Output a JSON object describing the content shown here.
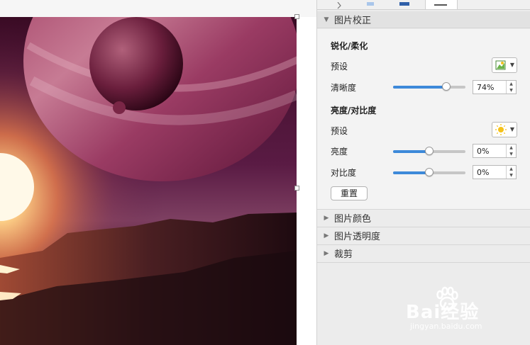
{
  "panel": {
    "section_open": {
      "title": "图片校正",
      "sharpen": {
        "heading": "锐化/柔化",
        "preset_label": "预设",
        "clarity_label": "清晰度",
        "clarity_value": "74%",
        "clarity_fraction": 0.74
      },
      "brightness_contrast": {
        "heading": "亮度/对比度",
        "preset_label": "预设",
        "brightness_label": "亮度",
        "brightness_value": "0%",
        "brightness_fraction": 0.5,
        "contrast_label": "对比度",
        "contrast_value": "0%",
        "contrast_fraction": 0.5
      },
      "reset_label": "重置"
    },
    "sections_closed": [
      {
        "title": "图片颜色"
      },
      {
        "title": "图片透明度"
      },
      {
        "title": "裁剪"
      }
    ]
  },
  "watermark": {
    "brand": "Bai经验",
    "url": "jingyan.baidu.com"
  },
  "colors": {
    "accent": "#3d89d9",
    "planet": "#8c2a55",
    "sun": "#ffd58a"
  },
  "icons": {
    "expanded": "triangle-down",
    "collapsed": "triangle-right",
    "sharpen_preset": "picture-icon",
    "brightness_preset": "sun-icon"
  }
}
